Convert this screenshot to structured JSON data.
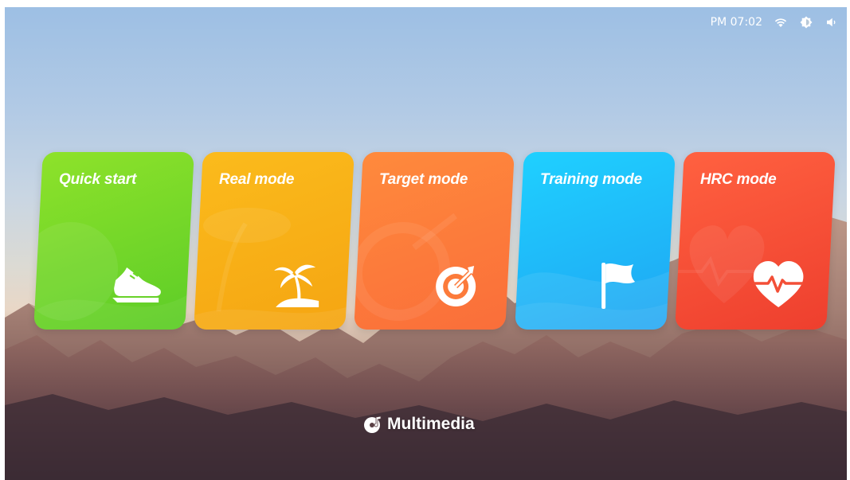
{
  "status_bar": {
    "time": "PM 07:02",
    "icons": [
      "wifi-icon",
      "brightness-icon",
      "volume-icon"
    ]
  },
  "modes": [
    {
      "label": "Quick start",
      "icon": "shoe-icon",
      "color": "#6fd72a"
    },
    {
      "label": "Real mode",
      "icon": "palm-tree-icon",
      "color": "#f8b018"
    },
    {
      "label": "Target mode",
      "icon": "target-icon",
      "color": "#fc7b3b"
    },
    {
      "label": "Training mode",
      "icon": "flag-icon",
      "color": "#1fbaf9"
    },
    {
      "label": "HRC mode",
      "icon": "heart-rate-icon",
      "color": "#f34f37"
    }
  ],
  "multimedia": {
    "label": "Multimedia",
    "icon": "music-disc-icon"
  }
}
